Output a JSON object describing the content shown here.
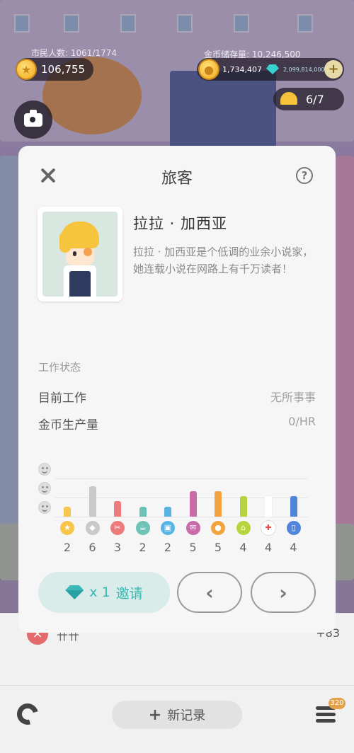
{
  "hud": {
    "population_caption": "市民人数: 1061/1774",
    "coins_caption": "金币储存量: 10,246,500",
    "stars_value": "106,755",
    "coins_value": "1,734,407",
    "gems_value": "2,099,814,000",
    "plus_symbol": "+",
    "helmet_value": "6/7"
  },
  "card": {
    "title": "旅客",
    "help_symbol": "?",
    "character": {
      "name": "拉拉 · 加西亚",
      "description": "拉拉 · 加西亚是个低调的业余小说家，她连载小说在网路上有千万读者！"
    },
    "work_status_label": "工作状态",
    "current_job_label": "目前工作",
    "current_job_value": "无所事事",
    "coin_output_label": "金币生产量",
    "coin_output_value": "0/HR",
    "invite": {
      "count": "x 1",
      "label": "邀请"
    },
    "prev_symbol": "‹",
    "next_symbol": "›"
  },
  "chart_data": {
    "type": "bar",
    "title": "",
    "categories": [
      "star",
      "tag",
      "tools",
      "cup",
      "bus",
      "mail",
      "game",
      "home",
      "health",
      "phone"
    ],
    "values": [
      2,
      6,
      3,
      2,
      2,
      5,
      5,
      4,
      4,
      4
    ],
    "colors": [
      "#f6c54b",
      "#c9c9c9",
      "#ee7b7b",
      "#6cc3b6",
      "#59b4e6",
      "#c96aa9",
      "#f3a43f",
      "#b7d53f",
      "#ffffff",
      "#4f86dc"
    ],
    "icons": [
      "star-icon",
      "tag-icon",
      "tools-icon",
      "cup-icon",
      "bus-icon",
      "mail-icon",
      "gamepad-icon",
      "home-icon",
      "health-icon",
      "phone-icon"
    ],
    "icon_glyphs": [
      "★",
      "◆",
      "✂",
      "☕",
      "▣",
      "✉",
      "●",
      "⌂",
      "✚",
      "▯"
    ],
    "ylim": [
      0,
      6
    ]
  },
  "bottom": {
    "list_name": "卄卄",
    "list_value": "+83",
    "new_record_plus": "+",
    "new_record_label": "新记录",
    "menu_badge": "320"
  }
}
